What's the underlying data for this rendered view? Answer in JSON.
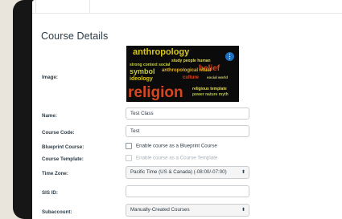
{
  "page": {
    "section_title": "Course Details"
  },
  "image_field": {
    "label": "Image:",
    "menu_icon": "more-options-icon",
    "words": [
      "anthropology",
      "religion",
      "symbol",
      "belief",
      "ideology",
      "culture"
    ]
  },
  "name_field": {
    "label": "Name:",
    "value": "Test Class"
  },
  "course_code_field": {
    "label": "Course Code:",
    "value": "Test"
  },
  "blueprint_field": {
    "label": "Blueprint Course:",
    "option": "Enable course as a Blueprint Course",
    "checked": false
  },
  "template_field": {
    "label": "Course Template:",
    "option": "Enable course as a Course Template",
    "checked": false,
    "disabled": true
  },
  "time_zone_field": {
    "label": "Time Zone:",
    "value": "Pacific Time (US & Canada) (-08:00/-07:00)"
  },
  "sis_id_field": {
    "label": "SIS ID:",
    "value": ""
  },
  "subaccount_field": {
    "label": "Subaccount:",
    "value": "Manually-Created Courses"
  },
  "colors": {
    "device": "#161616",
    "background": "#e9e4dc",
    "accent": "#1f6fbf",
    "word_yellow": "#d9c81c",
    "word_red": "#d8461f"
  }
}
